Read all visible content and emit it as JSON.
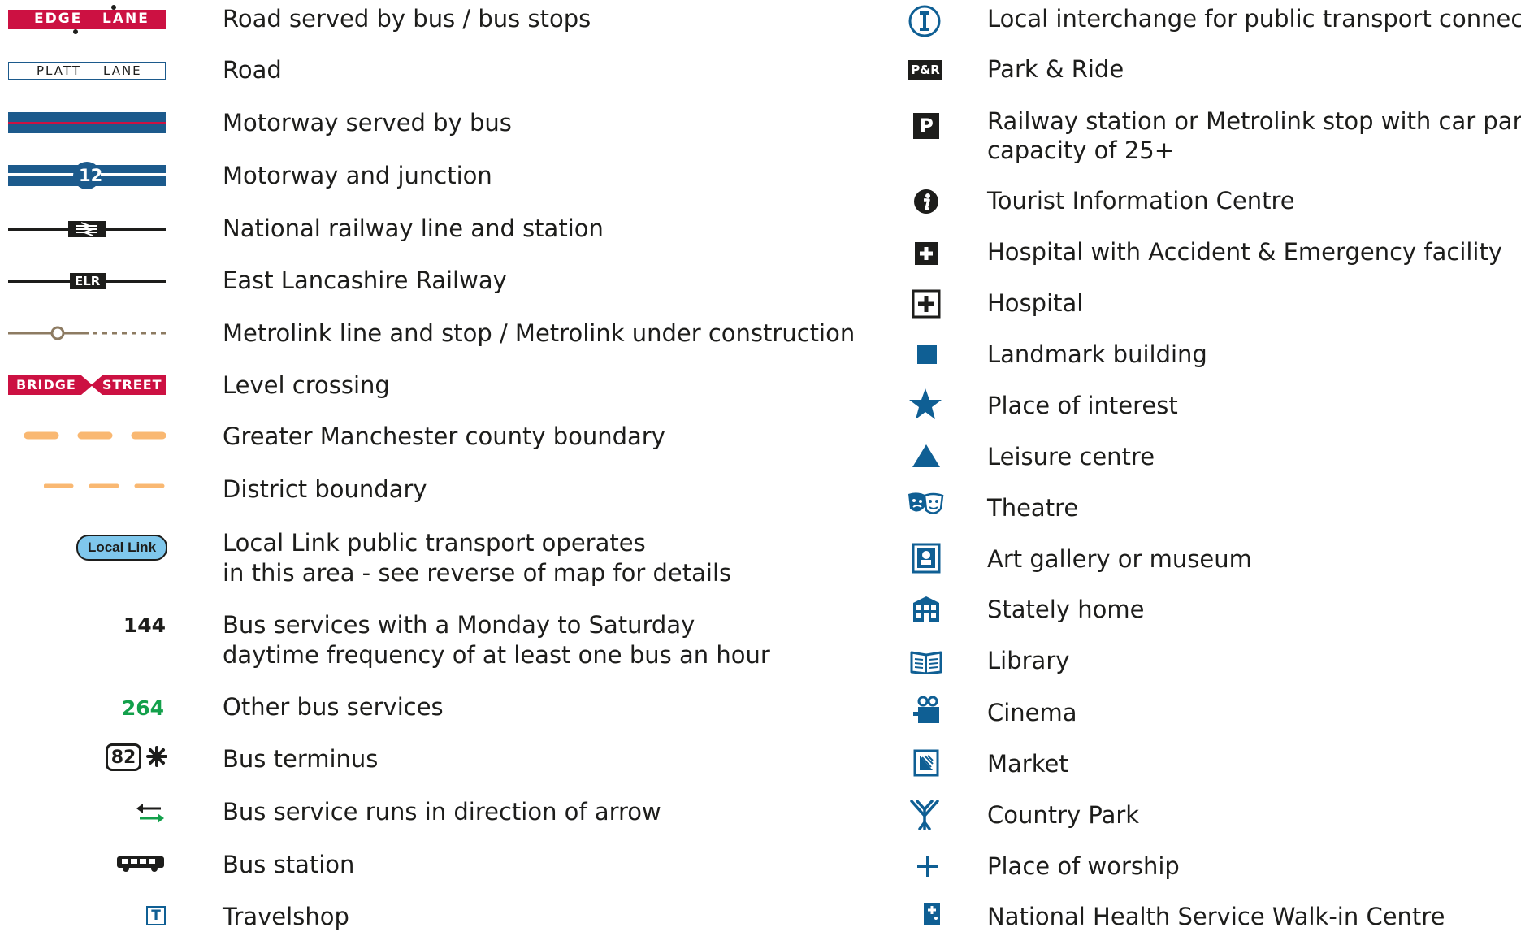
{
  "colors": {
    "bus_road": "#cc1142",
    "motorway": "#1c5a8c",
    "icon_blue": "#0f5f94",
    "boundary": "#f9b872",
    "metrolink": "#8d7b62",
    "other_bus": "#13a04b",
    "local_link_fill": "#7fc7ec",
    "black": "#1d1d1b"
  },
  "left_column": {
    "road_bus": {
      "symbol_text": [
        "EDGE",
        "LANE"
      ],
      "label": "Road served by bus / bus stops"
    },
    "road": {
      "symbol_text": [
        "PLATT",
        "LANE"
      ],
      "label": "Road"
    },
    "motorway_bus": {
      "label": "Motorway served by bus"
    },
    "motorway_junction": {
      "junction_number": "12",
      "label": "Motorway and junction"
    },
    "railway": {
      "icon": "national-rail-icon",
      "label": "National railway line and station"
    },
    "elr": {
      "symbol_text": "ELR",
      "label": "East Lancashire Railway"
    },
    "metrolink": {
      "label": "Metrolink line and stop / Metrolink under construction"
    },
    "level_crossing": {
      "symbol_text": [
        "BRIDGE",
        "STREET"
      ],
      "label": "Level crossing"
    },
    "county_boundary": {
      "label": "Greater Manchester county boundary"
    },
    "district_boundary": {
      "label": "District boundary"
    },
    "local_link": {
      "symbol_text": "Local Link",
      "label_lines": [
        "Local Link public transport operates",
        "in this area - see reverse of map for details"
      ]
    },
    "frequent_bus": {
      "symbol_text": "144",
      "label_lines": [
        "Bus services with a Monday to Saturday",
        "daytime frequency of at least one bus an hour"
      ]
    },
    "other_bus": {
      "symbol_text": "264",
      "label": "Other bus services"
    },
    "bus_terminus": {
      "symbol_text": "82",
      "label": "Bus terminus"
    },
    "bus_direction": {
      "icon": "direction-arrows-icon",
      "label": "Bus service runs in direction of arrow"
    },
    "bus_station": {
      "icon": "bus-icon",
      "label": "Bus station"
    },
    "travelshop": {
      "symbol_text": "T",
      "label": "Travelshop"
    }
  },
  "right_column": {
    "interchange": {
      "icon": "interchange-icon",
      "label": "Local interchange for public transport connections"
    },
    "park_ride": {
      "symbol_text": "P&R",
      "label": "Park & Ride"
    },
    "parking": {
      "symbol_text": "P",
      "label_lines": [
        "Railway station or Metrolink stop with car parking",
        "capacity of 25+"
      ]
    },
    "tourist_info": {
      "icon": "info-icon",
      "label": "Tourist Information Centre"
    },
    "hospital_ae": {
      "icon": "hospital-ae-icon",
      "label": "Hospital with Accident & Emergency facility"
    },
    "hospital": {
      "icon": "hospital-icon",
      "label": "Hospital"
    },
    "landmark": {
      "icon": "square-icon",
      "label": "Landmark building"
    },
    "place_of_interest": {
      "icon": "star-icon",
      "label": "Place of interest"
    },
    "leisure_centre": {
      "icon": "triangle-icon",
      "label": "Leisure centre"
    },
    "theatre": {
      "icon": "theatre-masks-icon",
      "label": "Theatre"
    },
    "art_gallery": {
      "icon": "museum-icon",
      "label": "Art gallery or museum"
    },
    "stately_home": {
      "icon": "stately-home-icon",
      "label": "Stately home"
    },
    "library": {
      "icon": "book-icon",
      "label": "Library"
    },
    "cinema": {
      "icon": "cinema-camera-icon",
      "label": "Cinema"
    },
    "market": {
      "icon": "market-icon",
      "label": "Market"
    },
    "country_park": {
      "icon": "tree-icon",
      "label": "Country Park"
    },
    "place_of_worship": {
      "icon": "cross-icon",
      "label": "Place of worship"
    },
    "nhs_walkin": {
      "icon": "nhs-walkin-icon",
      "label": "National Health Service Walk-in Centre"
    }
  }
}
